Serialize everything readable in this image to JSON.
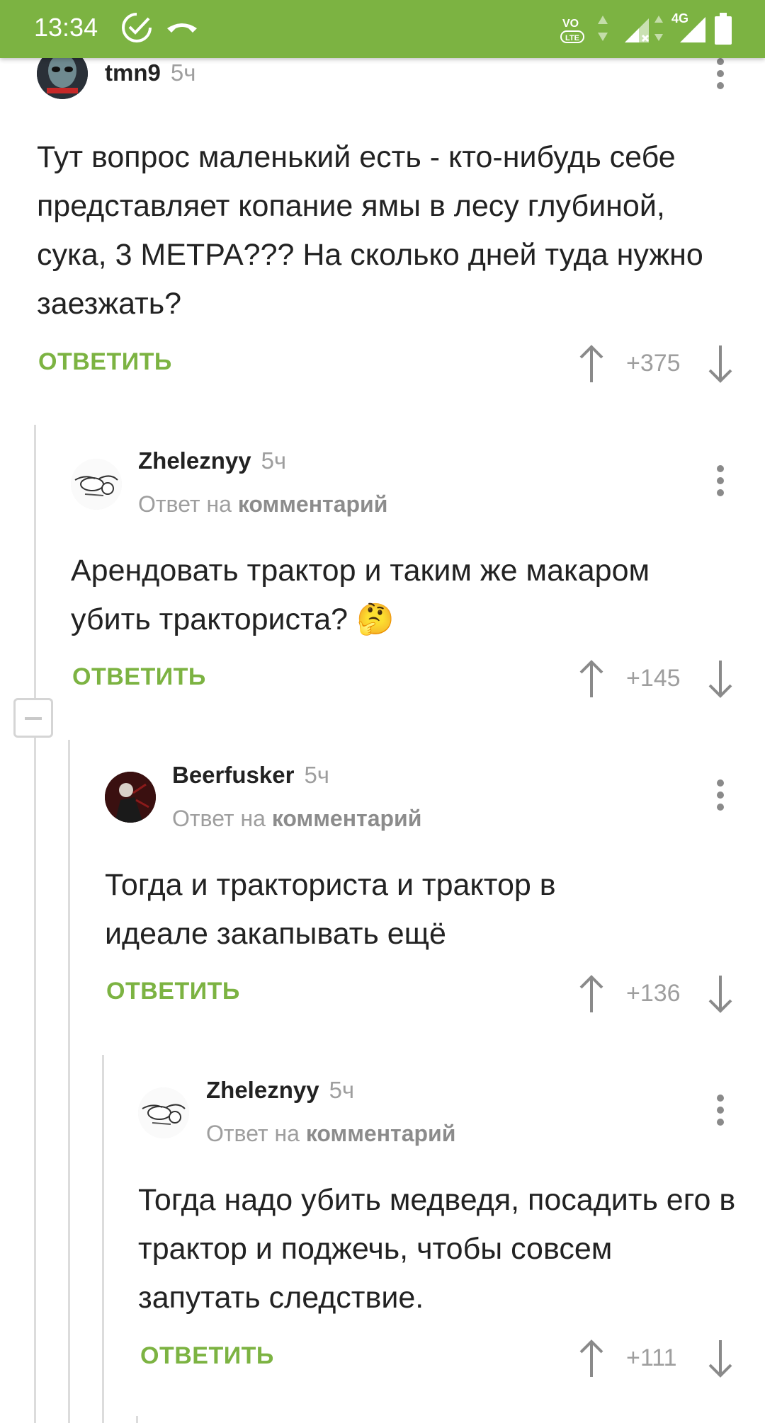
{
  "status_bar": {
    "time": "13:34",
    "network": "4G"
  },
  "colors": {
    "accent": "#7cb342",
    "muted": "#9e9e9e",
    "text": "#222222"
  },
  "comments": [
    {
      "author": "tmn9",
      "age": "5ч",
      "text": "Тут вопрос маленький есть - кто-нибудь себе представляет копание ямы в лесу глубиной, сука, 3 МЕТРА??? На сколько дней туда нужно заезжать?",
      "reply": "ОТВЕТИТЬ",
      "score": "+375"
    },
    {
      "author": "Zheleznyy",
      "age": "5ч",
      "reply_prefix": "Ответ на",
      "reply_target": "комментарий",
      "text": "Арендовать трактор и таким же макаром убить тракториста? 🤔",
      "reply": "ОТВЕТИТЬ",
      "score": "+145"
    },
    {
      "author": "Beerfusker",
      "age": "5ч",
      "reply_prefix": "Ответ на",
      "reply_target": "комментарий",
      "text": "Тогда и тракториста и трактор в идеале закапывать ещё",
      "reply": "ОТВЕТИТЬ",
      "score": "+136"
    },
    {
      "author": "Zheleznyy",
      "age": "5ч",
      "reply_prefix": "Ответ на",
      "reply_target": "комментарий",
      "text": "Тогда надо убить медведя, посадить его в трактор и поджечь, чтобы совсем запутать следствие.",
      "reply": "ОТВЕТИТЬ",
      "score": "+111"
    }
  ]
}
